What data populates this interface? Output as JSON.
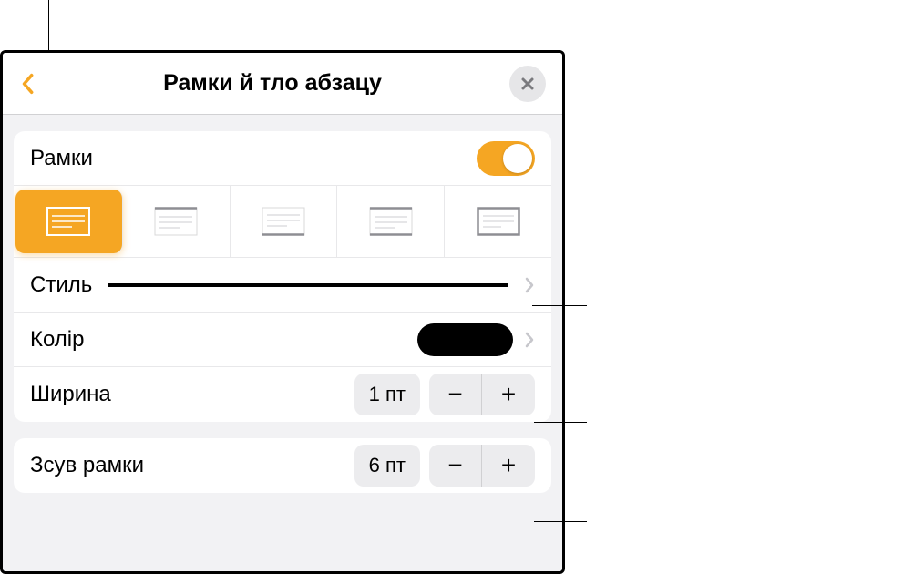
{
  "header": {
    "title": "Рамки й тло абзацу"
  },
  "borders": {
    "label": "Рамки",
    "toggle_on": true
  },
  "style": {
    "label": "Стиль"
  },
  "color": {
    "label": "Колір"
  },
  "width": {
    "label": "Ширина",
    "value": "1 пт"
  },
  "offset": {
    "label": "Зсув рамки",
    "value": "6 пт"
  },
  "stepper": {
    "minus": "−",
    "plus": "+"
  }
}
